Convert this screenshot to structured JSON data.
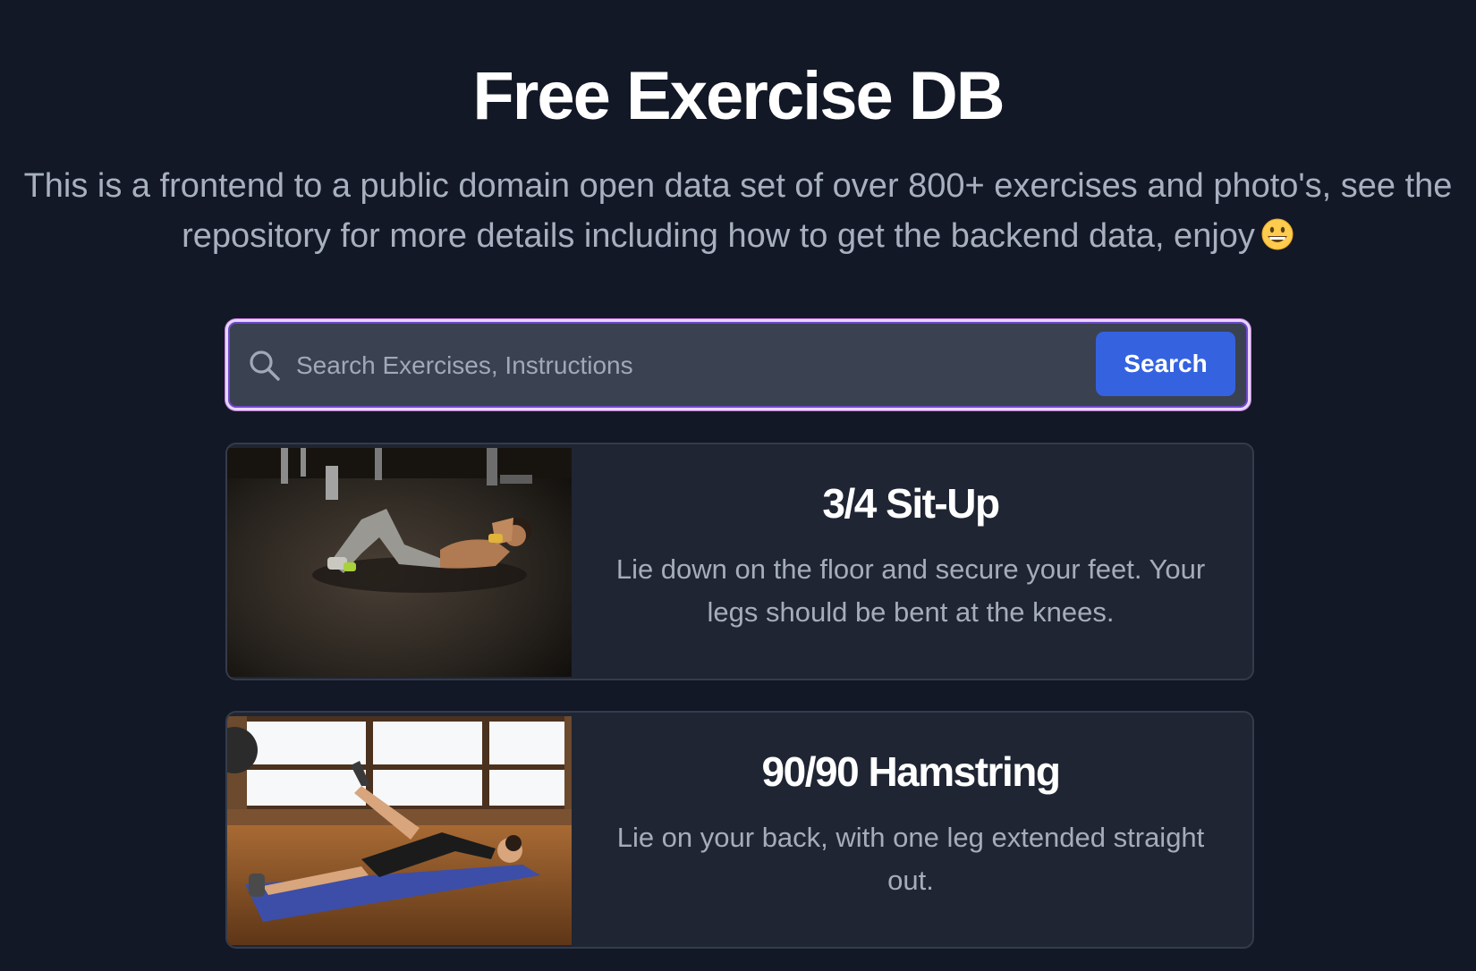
{
  "header": {
    "title": "Free Exercise DB",
    "subtitle": "This is a frontend to a public domain open data set of over 800+ exercises and photo's, see the repository for more details including how to get the backend data, enjoy",
    "emoji_icon": "grinning-face-emoji"
  },
  "search": {
    "placeholder": "Search Exercises, Instructions",
    "value": "",
    "button_label": "Search",
    "icon": "search-icon"
  },
  "colors": {
    "background": "#121826",
    "accent": "#3563e0",
    "card_background": "#1f2533",
    "focus_ring": "#c27ad6"
  },
  "exercises": [
    {
      "name": "3/4 Sit-Up",
      "description": "Lie down on the floor and secure your feet. Your legs should be bent at the knees.",
      "image": "situp-photo"
    },
    {
      "name": "90/90 Hamstring",
      "description": "Lie on your back, with one leg extended straight out.",
      "image": "hamstring-stretch-photo"
    }
  ]
}
